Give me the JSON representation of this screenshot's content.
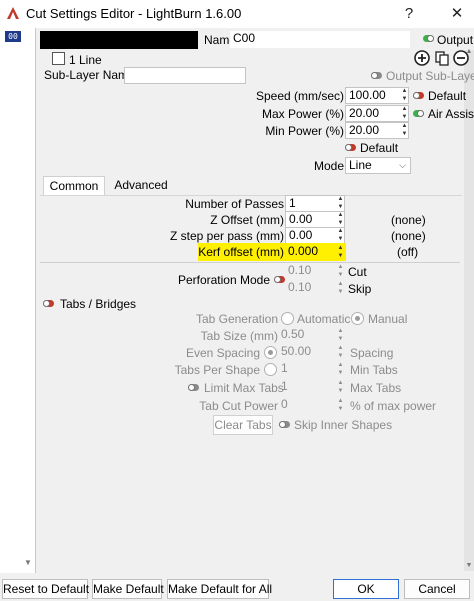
{
  "window": {
    "title": "Cut Settings Editor - LightBurn 1.6.00",
    "help_glyph": "?",
    "close_glyph": "✕"
  },
  "layer_list": {
    "selected": "00"
  },
  "header": {
    "name_label": "Name",
    "name_value": "C00",
    "output_label": "Output",
    "line_label": "1 Line",
    "sublayer_label": "Sub-Layer Name",
    "sublayer_value": "",
    "output_sublayer_label": "Output Sub-Layer"
  },
  "params": {
    "speed_label": "Speed (mm/sec)",
    "speed_value": "100.00",
    "default_label": "Default",
    "max_power_label": "Max Power (%)",
    "max_power_value": "20.00",
    "air_assist_label": "Air Assist",
    "min_power_label": "Min Power (%)",
    "min_power_value": "20.00",
    "default2_label": "Default",
    "mode_label": "Mode",
    "mode_value": "Line"
  },
  "tabs": {
    "common": "Common",
    "advanced": "Advanced"
  },
  "common": {
    "passes_label": "Number of Passes",
    "passes_value": "1",
    "zoffset_label": "Z Offset (mm)",
    "zoffset_value": "0.00",
    "zoffset_note": "(none)",
    "zstep_label": "Z step per pass (mm)",
    "zstep_value": "0.00",
    "zstep_note": "(none)",
    "kerf_label": "Kerf offset (mm)",
    "kerf_value": "0.000",
    "kerf_note": "(off)"
  },
  "perforation": {
    "label": "Perforation Mode",
    "cut_value": "0.10",
    "cut_label": "Cut",
    "skip_value": "0.10",
    "skip_label": "Skip"
  },
  "tabs_bridges": {
    "label": "Tabs / Bridges",
    "tab_generation_label": "Tab Generation",
    "automatic_label": "Automatic",
    "manual_label": "Manual",
    "tab_size_label": "Tab Size (mm)",
    "tab_size_value": "0.50",
    "even_spacing_label": "Even Spacing",
    "spacing_value": "50.00",
    "spacing_label": "Spacing",
    "tabs_per_shape_label": "Tabs Per Shape",
    "tabs_per_shape_value": "1",
    "min_tabs_label": "Min Tabs",
    "limit_max_tabs_label": "Limit Max Tabs",
    "limit_max_tabs_value": "1",
    "max_tabs_label": "Max Tabs",
    "tab_cut_power_label": "Tab Cut Power",
    "tab_cut_power_value": "0",
    "max_power_pct_label": "% of max power",
    "clear_tabs_label": "Clear Tabs",
    "skip_inner_label": "Skip Inner Shapes"
  },
  "footer": {
    "reset_default": "Reset to Default",
    "make_default": "Make Default",
    "make_default_all": "Make Default for All",
    "ok": "OK",
    "cancel": "Cancel"
  },
  "colors": {
    "toggle_on": "#3fae49",
    "toggle_off": "#8a8a8a",
    "toggle_red": "#c0392b",
    "highlight": "#ffef00",
    "ok_border": "#2f6fd6"
  }
}
